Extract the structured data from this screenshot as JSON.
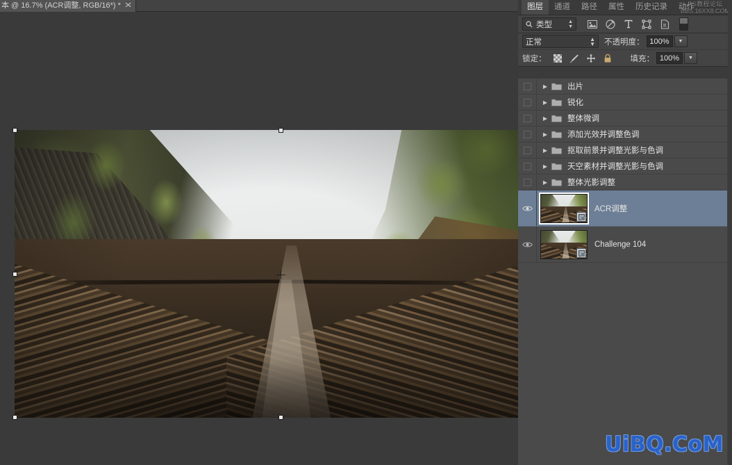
{
  "document": {
    "tab_title": "本 @ 16.7% (ACR调整, RGB/16*) *",
    "close_glyph": "✕",
    "zoom_level": "16.7%"
  },
  "panel": {
    "tabs": [
      {
        "label": "图层",
        "active": true
      },
      {
        "label": "通道",
        "active": false
      },
      {
        "label": "路径",
        "active": false
      },
      {
        "label": "属性",
        "active": false
      },
      {
        "label": "历史记录",
        "active": false
      },
      {
        "label": "动作",
        "active": false
      }
    ],
    "watermark_top_line1": "PS教程论坛",
    "watermark_top_line2": "BBS.16XX8.COM",
    "filter": {
      "search_icon": "search-icon",
      "kind_label": "类型",
      "icons": [
        {
          "name": "pixel-layer-filter-icon",
          "glyph": "▣"
        },
        {
          "name": "adjustment-layer-filter-icon",
          "glyph": "◍"
        },
        {
          "name": "type-layer-filter-icon",
          "glyph": "T"
        },
        {
          "name": "shape-layer-filter-icon",
          "glyph": "⬡"
        },
        {
          "name": "smart-object-filter-icon",
          "glyph": "▱"
        }
      ],
      "toggle_name": "filter-enable-switch"
    },
    "blend": {
      "mode": "正常",
      "opacity_label": "不透明度：",
      "opacity_value": "100%"
    },
    "lock": {
      "label": "锁定：",
      "icons": [
        {
          "name": "lock-transparency-icon"
        },
        {
          "name": "lock-image-pixels-icon"
        },
        {
          "name": "lock-position-icon"
        },
        {
          "name": "lock-all-icon"
        }
      ],
      "fill_label": "填充：",
      "fill_value": "100%"
    },
    "layers": [
      {
        "name": "出片",
        "type": "group",
        "visible": false,
        "selected": false,
        "expanded": false
      },
      {
        "name": "锐化",
        "type": "group",
        "visible": false,
        "selected": false,
        "expanded": false
      },
      {
        "name": "整体微调",
        "type": "group",
        "visible": false,
        "selected": false,
        "expanded": false
      },
      {
        "name": "添加光效并调整色调",
        "type": "group",
        "visible": false,
        "selected": false,
        "expanded": false
      },
      {
        "name": "抠取前景并调整光影与色调",
        "type": "group",
        "visible": false,
        "selected": false,
        "expanded": false
      },
      {
        "name": "天空素材并调整光影与色调",
        "type": "group",
        "visible": false,
        "selected": false,
        "expanded": false
      },
      {
        "name": "整体光影调整",
        "type": "group",
        "visible": false,
        "selected": false,
        "expanded": false
      },
      {
        "name": "ACR调整",
        "type": "smart-object",
        "visible": true,
        "selected": true
      },
      {
        "name": "Challenge 104",
        "type": "smart-object",
        "visible": true,
        "selected": false
      }
    ]
  },
  "watermark_bottom": {
    "text": "UiBQ.CoM",
    "color": "#2a62c8",
    "outline_color": "#6f9ae0"
  },
  "colors": {
    "panel_bg": "#3b3b3b",
    "list_bg": "#4a4a4a",
    "selection": "#6d7f96",
    "canvas_bg": "#3a3a3a",
    "toolbar_bg": "#444444"
  }
}
